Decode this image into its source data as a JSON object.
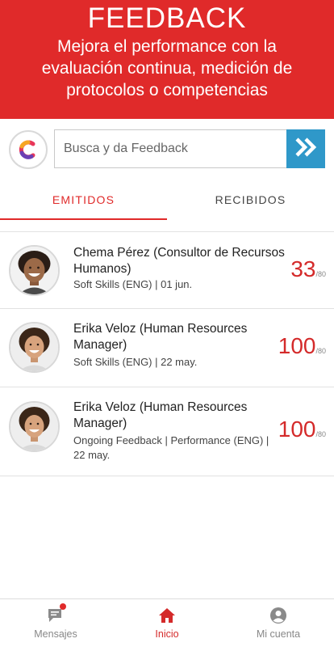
{
  "header": {
    "title": "FEEDBACK",
    "subtitle": "Mejora el performance con la evaluación continua, medición de protocolos o competencias"
  },
  "search": {
    "placeholder": "Busca y da Feedback",
    "logo_icon": "brand-c-logo-icon",
    "button_icon": "double-chevron-right-icon"
  },
  "tabs": [
    {
      "label": "EMITIDOS",
      "active": true
    },
    {
      "label": "RECIBIDOS",
      "active": false
    }
  ],
  "feedback_items": [
    {
      "name": "Chema Pérez (Consultor de Recursos Humanos)",
      "meta": "Soft Skills  (ENG) | 01 jun.",
      "score": "33",
      "max": "/80"
    },
    {
      "name": "Erika Veloz (Human Resources Manager)",
      "meta": "Soft Skills  (ENG) | 22 may.",
      "score": "100",
      "max": "/80"
    },
    {
      "name": "Erika Veloz (Human Resources Manager)",
      "meta": "Ongoing Feedback | Performance (ENG) | 22 may.",
      "score": "100",
      "max": "/80"
    }
  ],
  "bottom_nav": [
    {
      "label": "Mensajes",
      "icon": "chat-icon",
      "active": false,
      "badge": true
    },
    {
      "label": "Inicio",
      "icon": "home-icon",
      "active": true
    },
    {
      "label": "Mi cuenta",
      "icon": "account-icon",
      "active": false
    }
  ],
  "colors": {
    "brand_red": "#e02a2a",
    "search_button": "#2f98c9"
  }
}
